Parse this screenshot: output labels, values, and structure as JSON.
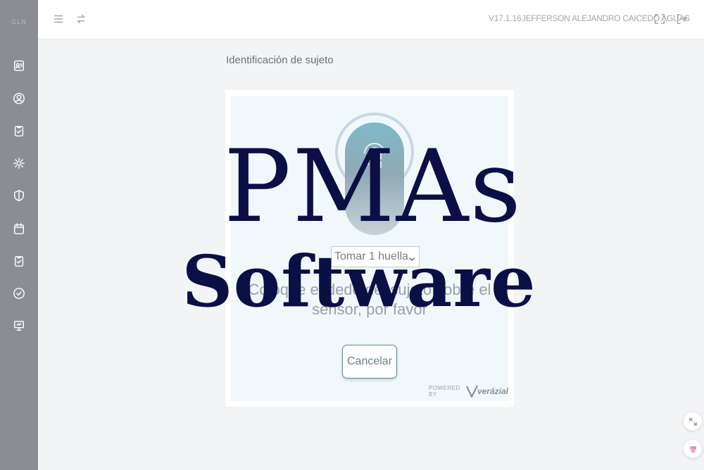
{
  "sidebar": {
    "brand": "GLN",
    "items": [
      {
        "icon": "id-card-icon"
      },
      {
        "icon": "user-circle-icon"
      },
      {
        "icon": "clipboard-check-icon"
      },
      {
        "icon": "gear-icon"
      },
      {
        "icon": "shield-icon"
      },
      {
        "icon": "calendar-icon"
      },
      {
        "icon": "clipboard-check-icon"
      },
      {
        "icon": "check-circle-icon"
      },
      {
        "icon": "presentation-icon"
      }
    ]
  },
  "topbar": {
    "menu_icon": "menu-icon",
    "swap_icon": "swap-arrows-icon",
    "version": "V17.1.16",
    "user": "JEFFERSON ALEJANDRO CAICEDO AGUAS",
    "fullscreen_icon": "expand-icon",
    "logout_icon": "logout-icon"
  },
  "page": {
    "title": "Identificación de sujeto"
  },
  "capture": {
    "mode_select_value": "Tomar 1 huella",
    "message": "Coloque el dedo del sujeto sobre el sensor, por favor",
    "cancel_label": "Cancelar",
    "powered_by": "POWERED BY",
    "vendor": "verázial"
  },
  "overlay": {
    "line1": "PMAs",
    "line2": "Software"
  },
  "colors": {
    "sidebar": "#8a8d93",
    "overlay_text": "#0a0f45",
    "button_border": "#5f8c93"
  }
}
